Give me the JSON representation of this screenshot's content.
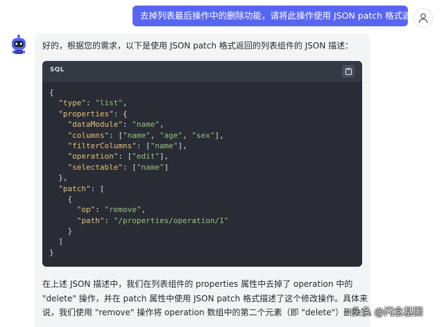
{
  "user_message": {
    "text": "去掉列表最后操作中的删除功能，请将此操作使用 JSON patch 格式返回",
    "avatar_icon": "user-outline-icon"
  },
  "assistant_message": {
    "avatar_icon": "robot-icon",
    "intro": "好的，根据您的需求，以下是使用 JSON patch 格式返回的列表组件的 JSON 描述：",
    "code_block": {
      "language": "SQL",
      "copy_icon": "copy-icon",
      "lines": [
        "{",
        "  \"type\": \"list\",",
        "  \"properties\": {",
        "    \"dataModule\": \"name\",",
        "    \"columns\": [\"name\", \"age\", \"sex\"],",
        "    \"filterColumns\": [\"name\"],",
        "    \"operation\": [\"edit\"],",
        "    \"selectable\": [\"name\"]",
        "  },",
        "  \"patch\": [",
        "    {",
        "      \"op\": \"remove\",",
        "      \"path\": \"/properties/operation/1\"",
        "    }",
        "  ]",
        "}"
      ]
    },
    "explanation_lines": [
      "在上述 JSON 描述中，我们在列表组件的 properties 属性中去掉了 operation 中的",
      "\"delete\" 操作，并在 patch 属性中使用 JSON patch 格式描述了这个修改操作。具体来",
      "说，我们使用 \"remove\" 操作将 operation 数组中的第二个元素（即 \"delete\"）删除了。"
    ]
  },
  "watermark": "头条 @闪念基因",
  "colors": {
    "user_bubble": "#5865f2",
    "code_bg": "#292c35",
    "code_header": "#353944",
    "json_key": "#e5c07b",
    "json_string": "#98c379"
  }
}
